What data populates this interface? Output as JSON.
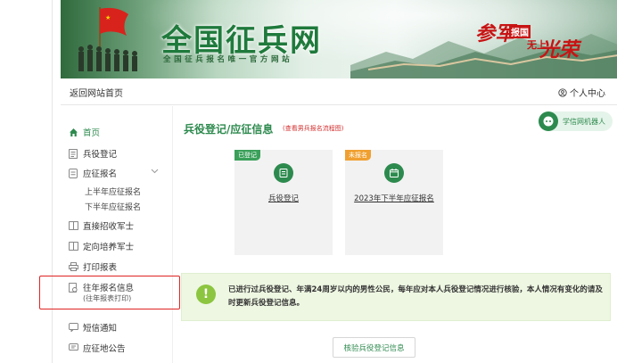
{
  "header": {
    "site_title": "全国征兵网",
    "site_subtitle": "全国征兵报名唯一官方网站",
    "slogan_a": "参军",
    "slogan_b": "报国",
    "slogan_c": "无上",
    "slogan_d": "光荣"
  },
  "navbar": {
    "back_home": "返回网站首页",
    "user_center": "个人中心"
  },
  "sidebar": {
    "items": [
      {
        "label": "首页",
        "icon": "home-icon"
      },
      {
        "label": "兵役登记",
        "icon": "register-icon"
      },
      {
        "label": "应征报名",
        "icon": "form-icon"
      },
      {
        "label": "直接招收军士",
        "icon": "book-icon"
      },
      {
        "label": "定向培养军士",
        "icon": "book-icon"
      },
      {
        "label": "打印报表",
        "icon": "print-icon"
      },
      {
        "label": "往年报名信息",
        "sublabel": "(往年报表打印)",
        "icon": "history-icon"
      },
      {
        "label": "短信通知",
        "icon": "message-icon"
      },
      {
        "label": "应征地公告",
        "icon": "notice-icon"
      }
    ],
    "sub_items": [
      "上半年应征报名",
      "下半年应征报名"
    ]
  },
  "main": {
    "title": "兵役登记/应征信息",
    "flow_link": "(查看男兵报名流程图)",
    "robot_label": "学信网机器人",
    "cards": [
      {
        "badge": "已登记",
        "badge_color": "#3aa05a",
        "label": "兵役登记"
      },
      {
        "badge": "未报名",
        "badge_color": "#f0a030",
        "label": "2023年下半年应征报名"
      }
    ],
    "notice": "已进行过兵役登记、年满24周岁以内的男性公民，每年应对本人兵役登记情况进行核验，本人情况有变化的请及时更新兵役登记信息。",
    "verify_button": "核验兵役登记信息"
  },
  "colors": {
    "accent": "#2d8a4e",
    "highlight": "#e02323",
    "notice_bg": "#eef7e2"
  }
}
